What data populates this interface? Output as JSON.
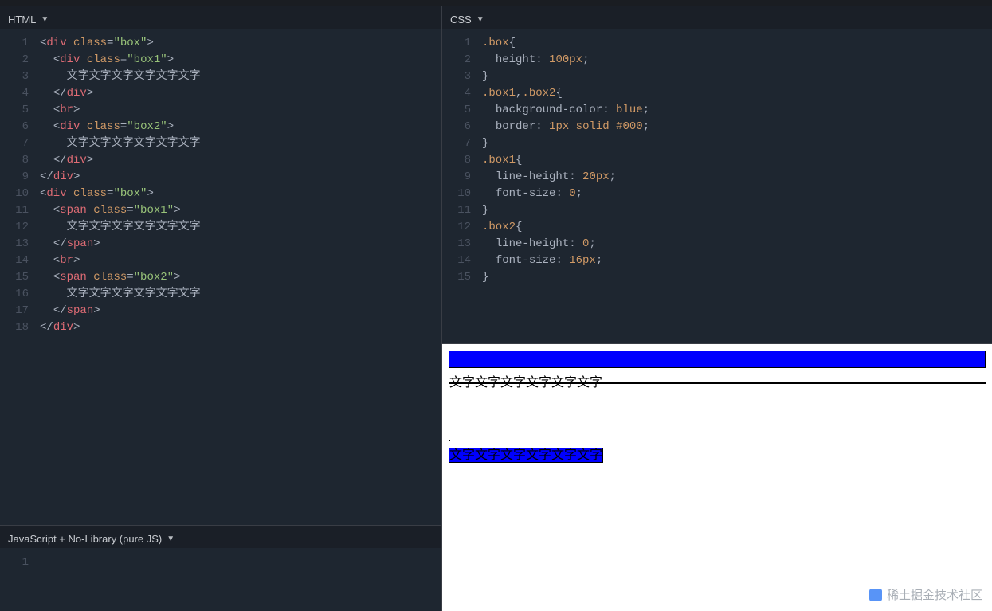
{
  "headers": {
    "html": "HTML",
    "css": "CSS",
    "js": "JavaScript + No-Library (pure JS)"
  },
  "triangle": "▼",
  "watermark": "稀土掘金技术社区",
  "sample_text": "文字文字文字文字文字文字",
  "html_code": [
    {
      "n": 1,
      "i": 0,
      "t": [
        [
          "punc",
          "<"
        ],
        [
          "tag",
          "div"
        ],
        [
          "txt",
          " "
        ],
        [
          "attr",
          "class"
        ],
        [
          "punc",
          "="
        ],
        [
          "str",
          "\"box\""
        ],
        [
          "punc",
          ">"
        ]
      ]
    },
    {
      "n": 2,
      "i": 1,
      "t": [
        [
          "punc",
          "<"
        ],
        [
          "tag",
          "div"
        ],
        [
          "txt",
          " "
        ],
        [
          "attr",
          "class"
        ],
        [
          "punc",
          "="
        ],
        [
          "str",
          "\"box1\""
        ],
        [
          "punc",
          ">"
        ]
      ]
    },
    {
      "n": 3,
      "i": 2,
      "t": [
        [
          "txt",
          "文字文字文字文字文字文字"
        ]
      ]
    },
    {
      "n": 4,
      "i": 1,
      "t": [
        [
          "punc",
          "</"
        ],
        [
          "tag",
          "div"
        ],
        [
          "punc",
          ">"
        ]
      ]
    },
    {
      "n": 5,
      "i": 1,
      "t": [
        [
          "punc",
          "<"
        ],
        [
          "tag",
          "br"
        ],
        [
          "punc",
          ">"
        ]
      ]
    },
    {
      "n": 6,
      "i": 1,
      "t": [
        [
          "punc",
          "<"
        ],
        [
          "tag",
          "div"
        ],
        [
          "txt",
          " "
        ],
        [
          "attr",
          "class"
        ],
        [
          "punc",
          "="
        ],
        [
          "str",
          "\"box2\""
        ],
        [
          "punc",
          ">"
        ]
      ]
    },
    {
      "n": 7,
      "i": 2,
      "t": [
        [
          "txt",
          "文字文字文字文字文字文字"
        ]
      ]
    },
    {
      "n": 8,
      "i": 1,
      "t": [
        [
          "punc",
          "</"
        ],
        [
          "tag",
          "div"
        ],
        [
          "punc",
          ">"
        ]
      ]
    },
    {
      "n": 9,
      "i": 0,
      "t": [
        [
          "punc",
          "</"
        ],
        [
          "tag",
          "div"
        ],
        [
          "punc",
          ">"
        ]
      ]
    },
    {
      "n": 10,
      "i": 0,
      "t": [
        [
          "punc",
          "<"
        ],
        [
          "tag",
          "div"
        ],
        [
          "txt",
          " "
        ],
        [
          "attr",
          "class"
        ],
        [
          "punc",
          "="
        ],
        [
          "str",
          "\"box\""
        ],
        [
          "punc",
          ">"
        ]
      ]
    },
    {
      "n": 11,
      "i": 1,
      "t": [
        [
          "punc",
          "<"
        ],
        [
          "tag",
          "span"
        ],
        [
          "txt",
          " "
        ],
        [
          "attr",
          "class"
        ],
        [
          "punc",
          "="
        ],
        [
          "str",
          "\"box1\""
        ],
        [
          "punc",
          ">"
        ]
      ]
    },
    {
      "n": 12,
      "i": 2,
      "t": [
        [
          "txt",
          "文字文字文字文字文字文字"
        ]
      ]
    },
    {
      "n": 13,
      "i": 1,
      "t": [
        [
          "punc",
          "</"
        ],
        [
          "tag",
          "span"
        ],
        [
          "punc",
          ">"
        ]
      ]
    },
    {
      "n": 14,
      "i": 1,
      "t": [
        [
          "punc",
          "<"
        ],
        [
          "tag",
          "br"
        ],
        [
          "punc",
          ">"
        ]
      ]
    },
    {
      "n": 15,
      "i": 1,
      "t": [
        [
          "punc",
          "<"
        ],
        [
          "tag",
          "span"
        ],
        [
          "txt",
          " "
        ],
        [
          "attr",
          "class"
        ],
        [
          "punc",
          "="
        ],
        [
          "str",
          "\"box2\""
        ],
        [
          "punc",
          ">"
        ]
      ]
    },
    {
      "n": 16,
      "i": 2,
      "t": [
        [
          "txt",
          "文字文字文字文字文字文字"
        ]
      ]
    },
    {
      "n": 17,
      "i": 1,
      "t": [
        [
          "punc",
          "</"
        ],
        [
          "tag",
          "span"
        ],
        [
          "punc",
          ">"
        ]
      ]
    },
    {
      "n": 18,
      "i": 0,
      "t": [
        [
          "punc",
          "</"
        ],
        [
          "tag",
          "div"
        ],
        [
          "punc",
          ">"
        ]
      ]
    }
  ],
  "css_code": [
    {
      "n": 1,
      "i": 0,
      "t": [
        [
          "sel",
          ".box"
        ],
        [
          "punc",
          "{"
        ]
      ]
    },
    {
      "n": 2,
      "i": 1,
      "t": [
        [
          "prop",
          "height"
        ],
        [
          "punc",
          ": "
        ],
        [
          "num",
          "100px"
        ],
        [
          "punc",
          ";"
        ]
      ]
    },
    {
      "n": 3,
      "i": 0,
      "t": [
        [
          "punc",
          "}"
        ]
      ]
    },
    {
      "n": 4,
      "i": 0,
      "t": [
        [
          "sel",
          ".box1"
        ],
        [
          "punc",
          ","
        ],
        [
          "sel",
          ".box2"
        ],
        [
          "punc",
          "{"
        ]
      ]
    },
    {
      "n": 5,
      "i": 1,
      "t": [
        [
          "prop",
          "background-color"
        ],
        [
          "punc",
          ": "
        ],
        [
          "val",
          "blue"
        ],
        [
          "punc",
          ";"
        ]
      ]
    },
    {
      "n": 6,
      "i": 1,
      "t": [
        [
          "prop",
          "border"
        ],
        [
          "punc",
          ": "
        ],
        [
          "num",
          "1px"
        ],
        [
          "txt",
          " "
        ],
        [
          "val",
          "solid"
        ],
        [
          "txt",
          " "
        ],
        [
          "num",
          "#000"
        ],
        [
          "punc",
          ";"
        ]
      ]
    },
    {
      "n": 7,
      "i": 0,
      "t": [
        [
          "punc",
          "}"
        ]
      ]
    },
    {
      "n": 8,
      "i": 0,
      "t": [
        [
          "sel",
          ".box1"
        ],
        [
          "punc",
          "{"
        ]
      ]
    },
    {
      "n": 9,
      "i": 1,
      "t": [
        [
          "prop",
          "line-height"
        ],
        [
          "punc",
          ": "
        ],
        [
          "num",
          "20px"
        ],
        [
          "punc",
          ";"
        ]
      ]
    },
    {
      "n": 10,
      "i": 1,
      "t": [
        [
          "prop",
          "font-size"
        ],
        [
          "punc",
          ": "
        ],
        [
          "num",
          "0"
        ],
        [
          "punc",
          ";"
        ]
      ]
    },
    {
      "n": 11,
      "i": 0,
      "t": [
        [
          "punc",
          "}"
        ]
      ]
    },
    {
      "n": 12,
      "i": 0,
      "t": [
        [
          "sel",
          ".box2"
        ],
        [
          "punc",
          "{"
        ]
      ]
    },
    {
      "n": 13,
      "i": 1,
      "t": [
        [
          "prop",
          "line-height"
        ],
        [
          "punc",
          ": "
        ],
        [
          "num",
          "0"
        ],
        [
          "punc",
          ";"
        ]
      ]
    },
    {
      "n": 14,
      "i": 1,
      "t": [
        [
          "prop",
          "font-size"
        ],
        [
          "punc",
          ": "
        ],
        [
          "num",
          "16px"
        ],
        [
          "punc",
          ";"
        ]
      ]
    },
    {
      "n": 15,
      "i": 0,
      "t": [
        [
          "punc",
          "}"
        ]
      ]
    }
  ],
  "js_code": [
    {
      "n": 1,
      "i": 0,
      "t": []
    }
  ]
}
